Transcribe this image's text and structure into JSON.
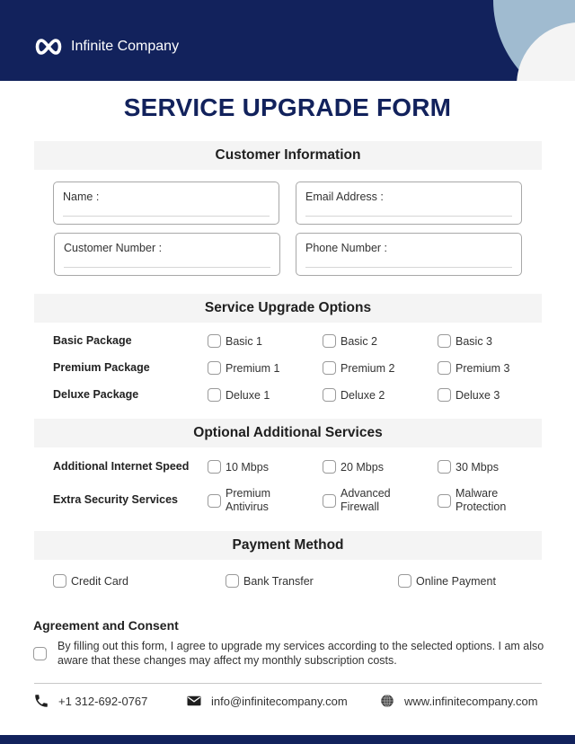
{
  "brand": {
    "name": "Infinite Company",
    "logo_icon": "infinity-icon",
    "colors": {
      "primary": "#12225c",
      "accent": "#a0bbd0",
      "section_bg": "#f4f4f4"
    }
  },
  "title": "SERVICE UPGRADE FORM",
  "customer_info": {
    "heading": "Customer Information",
    "fields": [
      {
        "label": "Name :",
        "value": ""
      },
      {
        "label": "Email Address :",
        "value": ""
      },
      {
        "label": "Customer Number :",
        "value": ""
      },
      {
        "label": "Phone Number :",
        "value": ""
      }
    ]
  },
  "upgrade_options": {
    "heading": "Service Upgrade Options",
    "rows": [
      {
        "label": "Basic Package",
        "options": [
          "Basic 1",
          "Basic 2",
          "Basic 3"
        ]
      },
      {
        "label": "Premium Package",
        "options": [
          "Premium 1",
          "Premium 2",
          "Premium 3"
        ]
      },
      {
        "label": "Deluxe Package",
        "options": [
          "Deluxe 1",
          "Deluxe 2",
          "Deluxe 3"
        ]
      }
    ]
  },
  "additional_services": {
    "heading": "Optional Additional Services",
    "rows": [
      {
        "label": "Additional Internet Speed",
        "options": [
          {
            "line1": "10 Mbps",
            "line2": ""
          },
          {
            "line1": "20 Mbps",
            "line2": ""
          },
          {
            "line1": "30 Mbps",
            "line2": ""
          }
        ]
      },
      {
        "label": "Extra Security Services",
        "options": [
          {
            "line1": "Premium",
            "line2": "Antivirus"
          },
          {
            "line1": "Advanced",
            "line2": "Firewall"
          },
          {
            "line1": "Malware",
            "line2": "Protection"
          }
        ]
      }
    ]
  },
  "payment": {
    "heading": "Payment Method",
    "options": [
      "Credit Card",
      "Bank Transfer",
      "Online Payment"
    ]
  },
  "agreement": {
    "heading": "Agreement and Consent",
    "line1": "By filling out this form, I agree to upgrade my services according to the selected options. I am also",
    "line2": "aware that these changes may affect my monthly subscription costs."
  },
  "contact": {
    "phone": {
      "icon": "phone-icon",
      "text": "+1 312-692-0767"
    },
    "email": {
      "icon": "envelope-icon",
      "text": "info@infinitecompany.com"
    },
    "website": {
      "icon": "globe-icon",
      "text": "www.infinitecompany.com"
    }
  }
}
